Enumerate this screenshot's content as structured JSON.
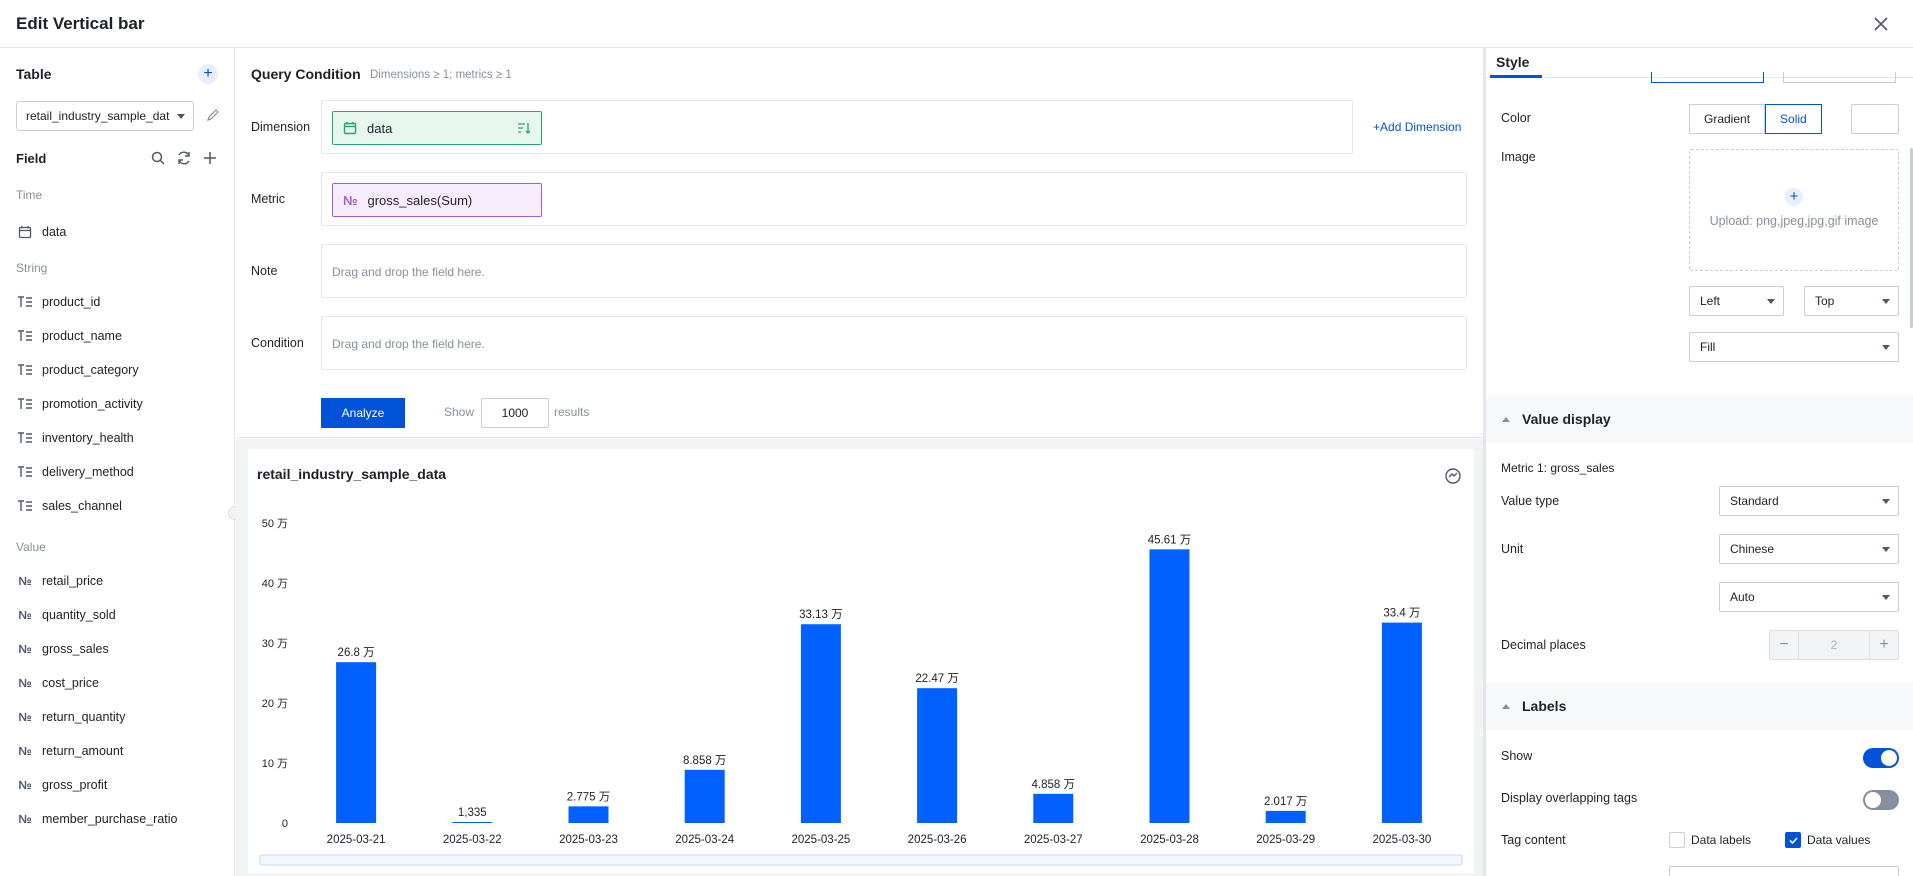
{
  "window": {
    "title": "Edit Vertical bar"
  },
  "left": {
    "table_title": "Table",
    "table_select": "retail_industry_sample_dat",
    "field_title": "Field",
    "groups": {
      "time": "Time",
      "string": "String",
      "value": "Value"
    },
    "time_fields": [
      "data"
    ],
    "string_fields": [
      "product_id",
      "product_name",
      "product_category",
      "promotion_activity",
      "inventory_health",
      "delivery_method",
      "sales_channel"
    ],
    "value_fields": [
      "retail_price",
      "quantity_sold",
      "gross_sales",
      "cost_price",
      "return_quantity",
      "return_amount",
      "gross_profit",
      "member_purchase_ratio"
    ]
  },
  "query": {
    "title": "Query Condition",
    "subtitle": "Dimensions ≥ 1; metrics ≥ 1",
    "dimension_label": "Dimension",
    "dimension_chip": "data",
    "add_dimension": "Add Dimension",
    "metric_label": "Metric",
    "metric_chip": "gross_sales(Sum)",
    "note_label": "Note",
    "note_hint": "Drag and drop the field here.",
    "condition_label": "Condition",
    "condition_hint": "Drag and drop the field here.",
    "analyze": "Analyze",
    "show_label": "Show",
    "show_value": "1000",
    "results_label": "results"
  },
  "chart_data": {
    "type": "bar",
    "title": "retail_industry_sample_data",
    "categories": [
      "2025-03-21",
      "2025-03-22",
      "2025-03-23",
      "2025-03-24",
      "2025-03-25",
      "2025-03-26",
      "2025-03-27",
      "2025-03-28",
      "2025-03-29",
      "2025-03-30"
    ],
    "values": [
      268000,
      1335,
      27750,
      88580,
      331300,
      224700,
      48580,
      456100,
      20170,
      334000
    ],
    "data_labels": [
      "26.8 万",
      "1,335",
      "2.775 万",
      "8.858 万",
      "33.13 万",
      "22.47 万",
      "4.858 万",
      "45.61 万",
      "2.017 万",
      "33.4 万"
    ],
    "y_ticks": [
      0,
      100000,
      200000,
      300000,
      400000,
      500000
    ],
    "y_tick_labels": [
      "0",
      "10 万",
      "20 万",
      "30 万",
      "40 万",
      "50 万"
    ],
    "ylim": [
      0,
      500000
    ],
    "bar_color": "#0061ff",
    "grid": false
  },
  "style": {
    "tab": "Style",
    "color_label": "Color",
    "gradient": "Gradient",
    "solid": "Solid",
    "image_label": "Image",
    "upload_text": "Upload: png,jpeg,jpg,gif image",
    "h_align": "Left",
    "v_align": "Top",
    "fit": "Fill",
    "value_display_title": "Value display",
    "metric_line": "Metric 1: gross_sales",
    "value_type_label": "Value type",
    "value_type": "Standard",
    "unit_label": "Unit",
    "unit": "Chinese",
    "unit_mode": "Auto",
    "decimal_label": "Decimal places",
    "decimal_value": "2",
    "labels_title": "Labels",
    "show_label": "Show",
    "overlap_label": "Display overlapping tags",
    "tag_content_label": "Tag content",
    "data_labels_opt": "Data labels",
    "data_values_opt": "Data values",
    "accent": "#0052d9"
  }
}
